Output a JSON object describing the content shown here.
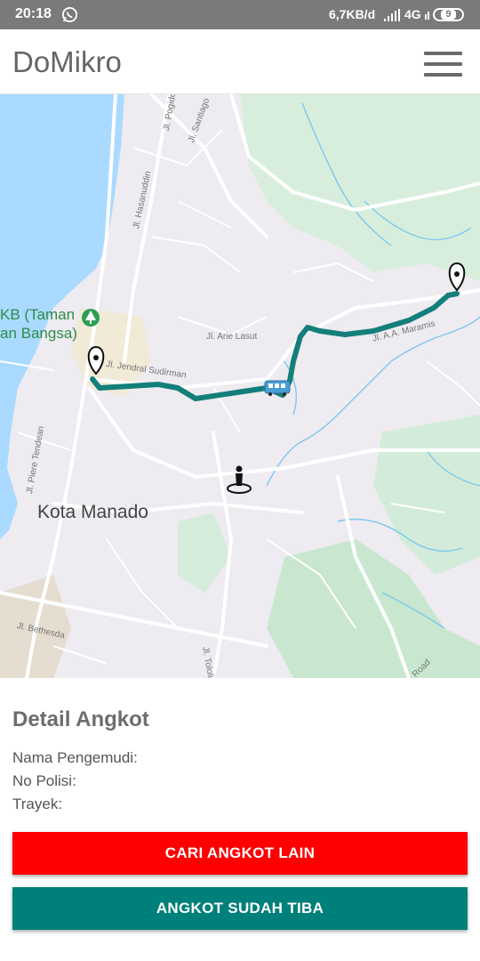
{
  "status_bar": {
    "time": "20:18",
    "network_speed": "6,7KB/d",
    "network_type": "4G",
    "battery_level": "9",
    "icons": [
      "whatsapp-icon",
      "signal-icon",
      "battery-icon"
    ]
  },
  "app_bar": {
    "title": "DoMikro",
    "menu_icon": "hamburger-menu-icon"
  },
  "map": {
    "labels": {
      "city": "Kota Manado",
      "poi_line1": "KB (Taman",
      "poi_line2": "an Bangsa)",
      "street_pogidon": "Jl. Pogidon",
      "street_santiago": "Jl. Santiago",
      "street_hasanuddin": "Jl. Hasanuddin",
      "street_arie_lasut": "Jl. Arie Lasut",
      "street_sudirman": "Jl. Jendral Sudirman",
      "street_maramis": "Jl. A.A. Maramis",
      "street_piere_tendean": "Jl. Piere Tendean",
      "street_bethesda": "Jl. Bethesda",
      "street_tololiu": "Jl. Tololiu",
      "street_road": "Road"
    },
    "markers": [
      "origin-pin-icon",
      "destination-pin-icon",
      "bus-icon",
      "user-location-icon",
      "park-icon"
    ],
    "colors": {
      "route": "#147f7a",
      "water": "#aadaff",
      "land": "#eeebf1",
      "park": "#c9ecd4"
    }
  },
  "detail": {
    "title": "Detail Angkot",
    "driver_label": "Nama Pengemudi:",
    "plate_label": "No Polisi:",
    "route_label": "Trayek:"
  },
  "buttons": {
    "find_other": "CARI ANGKOT LAIN",
    "arrived": "ANGKOT SUDAH TIBA",
    "colors": {
      "find_other": "#fe0000",
      "arrived": "#00807a"
    }
  }
}
